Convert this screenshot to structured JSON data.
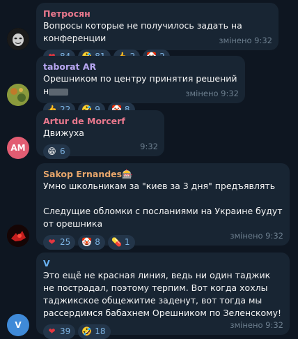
{
  "messages": [
    {
      "sender": "Петросян",
      "text": "Вопросы которые не получилось задать на конференции",
      "reactions": [
        {
          "emoji": "heart-emoji",
          "glyph": "❤",
          "count": "84"
        },
        {
          "emoji": "rofl-emoji",
          "glyph": "🤣",
          "count": "81"
        },
        {
          "emoji": "thumbs-up-emoji",
          "glyph": "👍",
          "count": "2"
        },
        {
          "emoji": "clown-emoji",
          "glyph": "🤡",
          "count": "2"
        }
      ],
      "time": "змінено 9:32",
      "sender_color": "#e9788d"
    },
    {
      "sender": "taborat AR",
      "text": "Орешником по центру принятия решений н",
      "reactions": [
        {
          "emoji": "thumbs-up-emoji",
          "glyph": "👍",
          "count": "22"
        },
        {
          "emoji": "rofl-emoji",
          "glyph": "🤣",
          "count": "9"
        },
        {
          "emoji": "clown-emoji",
          "glyph": "🤡",
          "count": "8"
        }
      ],
      "time": "змінено 9:32",
      "sender_color": "#b8a7f2"
    },
    {
      "sender": "Artur de Morcerf",
      "text": "Движуха",
      "reactions": [
        {
          "emoji": "grin-emoji",
          "glyph": "😁",
          "count": "6"
        }
      ],
      "time": "9:32",
      "avatar_initials": "AM",
      "sender_color": "#e9788d"
    },
    {
      "sender": "Sakop Ernandes🎰",
      "text": "Умно школьникам за \"киев за 3 дня\" предъявлять\n\nСледущие обломки с посланиями на Украине будут  от орешника",
      "reactions": [
        {
          "emoji": "heart-emoji",
          "glyph": "❤",
          "count": "25"
        },
        {
          "emoji": "clown-emoji",
          "glyph": "🤡",
          "count": "8"
        },
        {
          "emoji": "pill-emoji",
          "glyph": "💊",
          "count": "1"
        }
      ],
      "time": "змінено 9:32",
      "sender_color": "#e8a66b"
    },
    {
      "sender": "V",
      "text": "Это ещё не красная линия, ведь ни один таджик не пострадал, поэтому терпим. Вот когда хохлы  таджикское общежитие заденут, вот тогда мы рассердимся бабахнем Орешником по Зеленскому!",
      "reactions": [
        {
          "emoji": "heart-emoji",
          "glyph": "❤",
          "count": "39"
        },
        {
          "emoji": "rofl-emoji",
          "glyph": "🤣",
          "count": "18"
        }
      ],
      "time": "змінено 9:32",
      "avatar_initials": "V",
      "sender_color": "#6ab3f3"
    }
  ],
  "colors": {
    "background": "#0e1621",
    "bubble": "#182533",
    "reaction_bg": "#233549",
    "reaction_count": "#7fb6e6",
    "avatar_am": "#e25c72",
    "avatar_v": "#3f8ad8"
  }
}
